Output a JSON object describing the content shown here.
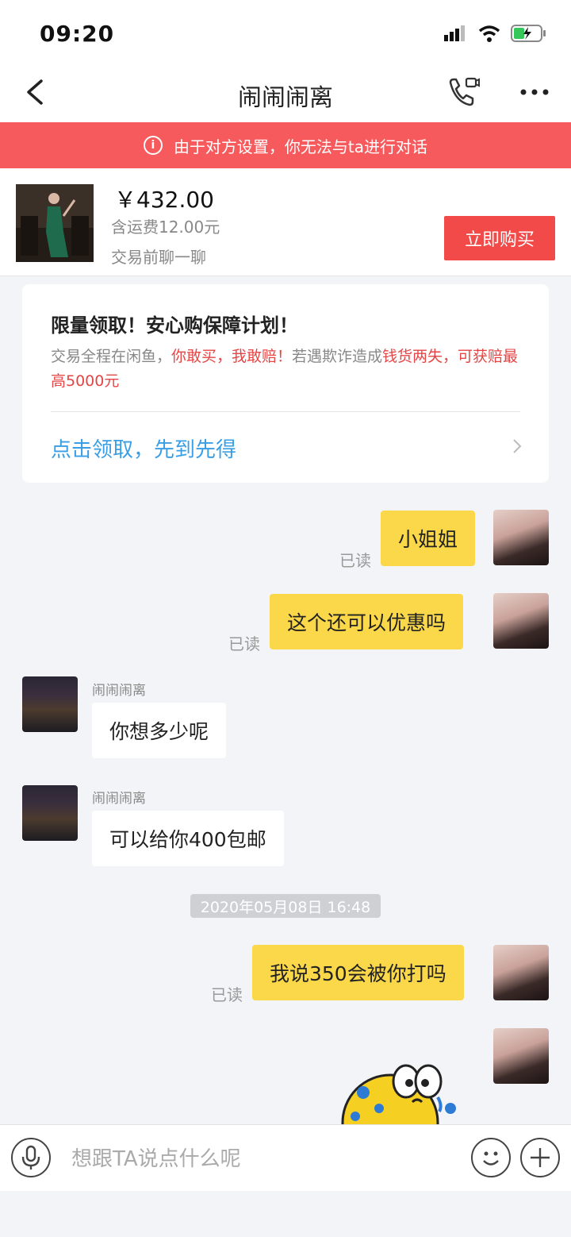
{
  "status": {
    "time": "09:20"
  },
  "header": {
    "title": "闹闹闹离"
  },
  "banner": {
    "text": "由于对方设置，你无法与ta进行对话"
  },
  "product": {
    "price": "￥432.00",
    "shipping": "含运费12.00元",
    "chat_hint": "交易前聊一聊",
    "buy_label": "立即购买"
  },
  "promo": {
    "title": "限量领取！安心购保障计划！",
    "desc_1": "交易全程在闲鱼，",
    "desc_red_1": "你敢买，我敢赔！",
    "desc_2": "若遇欺诈造成",
    "desc_red_2": "钱货两失，可获赔最高5000元",
    "link": "点击领取，先到先得"
  },
  "messages": [
    {
      "from": "self",
      "text": "小姐姐",
      "read": "已读"
    },
    {
      "from": "self",
      "text": "这个还可以优惠吗",
      "read": "已读"
    },
    {
      "from": "other",
      "sender": "闹闹闹离",
      "text": "你想多少呢"
    },
    {
      "from": "other",
      "sender": "闹闹闹离",
      "text": "可以给你400包邮"
    },
    {
      "from": "self",
      "text": "我说350会被你打吗",
      "read": "已读"
    }
  ],
  "timestamp": "2020年05月08日 16:48",
  "input": {
    "placeholder": "想跟TA说点什么呢"
  },
  "colors": {
    "banner": "#f75a5d",
    "buy": "#f24a48",
    "bubble_self": "#fbd84a",
    "link": "#3a9ee5"
  }
}
